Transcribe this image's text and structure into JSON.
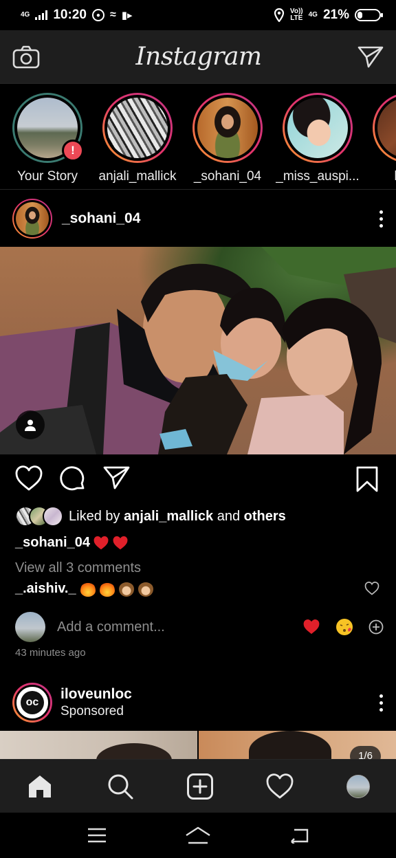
{
  "status_bar": {
    "network_left": "4G",
    "time": "10:20",
    "volte": "Vo))\nLTE",
    "network_right": "4G",
    "battery": "21%"
  },
  "app": {
    "title": "Instagram"
  },
  "stories": [
    {
      "name": "Your Story",
      "seen": true,
      "has_alert": true,
      "alert_glyph": "!"
    },
    {
      "name": "anjali_mallick",
      "seen": false
    },
    {
      "name": "_sohani_04",
      "seen": false
    },
    {
      "name": "_miss_auspi...",
      "seen": false
    },
    {
      "name": "bijay",
      "seen": false
    }
  ],
  "post": {
    "username": "_sohani_04",
    "liked_prefix": "Liked by ",
    "liked_user": "anjali_mallick",
    "liked_mid": " and ",
    "liked_suffix": "others",
    "caption_user": "_sohani_04",
    "view_all": "View all 3 comments",
    "comment_user": "_.aishiv._",
    "add_comment_placeholder": "Add a comment...",
    "timestamp": "43 minutes ago"
  },
  "sponsored": {
    "name": "iloveunloc",
    "label": "Sponsored",
    "logo_text": "oc",
    "counter": "1/6"
  },
  "colors": {
    "accent_red": "#ed4956",
    "story_gradient_start": "#f9a12a",
    "story_gradient_end": "#c13584",
    "muted_text": "#8e8e8e",
    "bar_bg": "#1e1e1e"
  },
  "icons": {
    "appbar_left": "camera-icon",
    "appbar_right": "direct-send-icon",
    "nav": [
      "home-icon",
      "search-icon",
      "new-post-icon",
      "activity-heart-icon",
      "profile-avatar"
    ],
    "system_nav": [
      "menu-icon",
      "home-outline-icon",
      "back-icon"
    ]
  }
}
